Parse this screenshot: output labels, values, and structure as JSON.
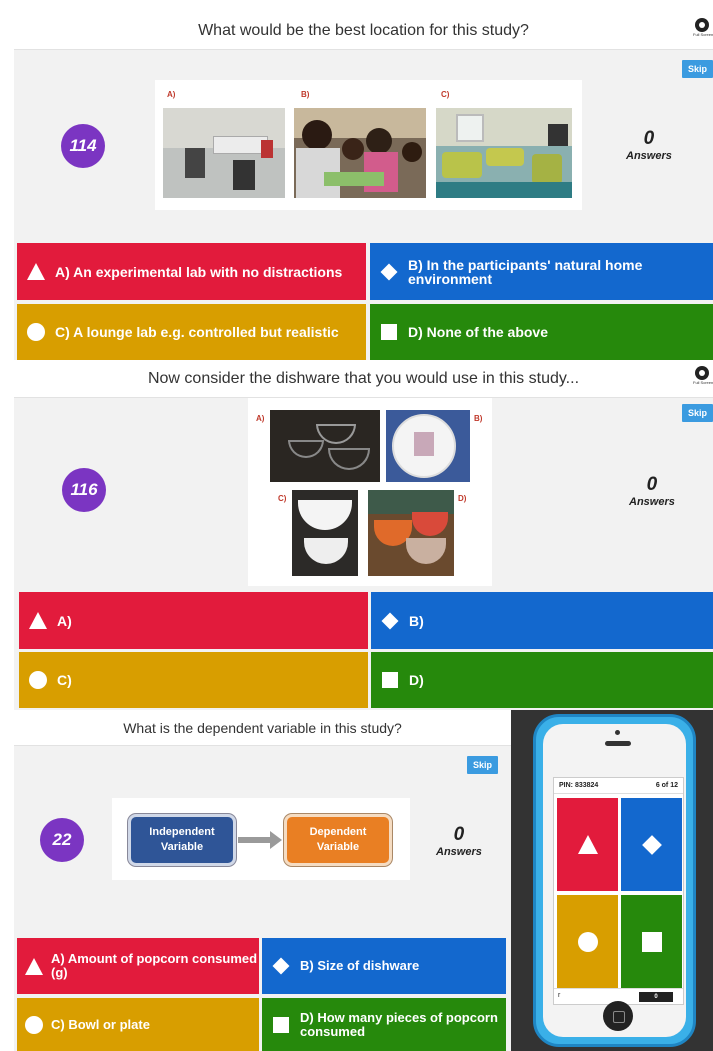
{
  "screen1": {
    "question": "What would be the best location for this study?",
    "skip": "Skip",
    "qnum": "114",
    "answers_count": "0",
    "answers_label": "Answers",
    "fullscreen_label": "Full Screen",
    "image_labels": [
      "A)",
      "B)",
      "C)"
    ],
    "options": [
      {
        "text": "A) An experimental lab with no distractions",
        "color": "#e21b3c",
        "icon": "triangle-icon"
      },
      {
        "text": "B) In the participants' natural home environment",
        "color": "#1368ce",
        "icon": "diamond-icon"
      },
      {
        "text": "C) A lounge lab e.g. controlled but realistic",
        "color": "#d89e00",
        "icon": "circle-icon"
      },
      {
        "text": "D) None of the above",
        "color": "#26890c",
        "icon": "square-icon"
      }
    ]
  },
  "screen2": {
    "question": "Now consider the dishware that you would use in this study...",
    "skip": "Skip",
    "qnum": "116",
    "answers_count": "0",
    "answers_label": "Answers",
    "fullscreen_label": "Full Screen",
    "image_labels": [
      "A)",
      "B)",
      "C)",
      "D)"
    ],
    "options": [
      {
        "text": "A)",
        "color": "#e21b3c",
        "icon": "triangle-icon"
      },
      {
        "text": "B)",
        "color": "#1368ce",
        "icon": "diamond-icon"
      },
      {
        "text": "C)",
        "color": "#d89e00",
        "icon": "circle-icon"
      },
      {
        "text": "D)",
        "color": "#26890c",
        "icon": "square-icon"
      }
    ]
  },
  "screen3": {
    "question": "What is the dependent variable in this study?",
    "skip": "Skip",
    "qnum": "22",
    "answers_count": "0",
    "answers_label": "Answers",
    "diagram": {
      "left": "Independent Variable",
      "right": "Dependent Variable"
    },
    "options": [
      {
        "text": "A) Amount of popcorn consumed (g)",
        "color": "#e21b3c",
        "icon": "triangle-icon"
      },
      {
        "text": "B) Size of dishware",
        "color": "#1368ce",
        "icon": "diamond-icon"
      },
      {
        "text": "C) Bowl or plate",
        "color": "#d89e00",
        "icon": "circle-icon"
      },
      {
        "text": "D) How many pieces of popcorn consumed",
        "color": "#26890c",
        "icon": "square-icon"
      }
    ]
  },
  "phone": {
    "pin": "PIN: 833824",
    "progress": "6 of 12",
    "player": "r",
    "score": "0"
  }
}
